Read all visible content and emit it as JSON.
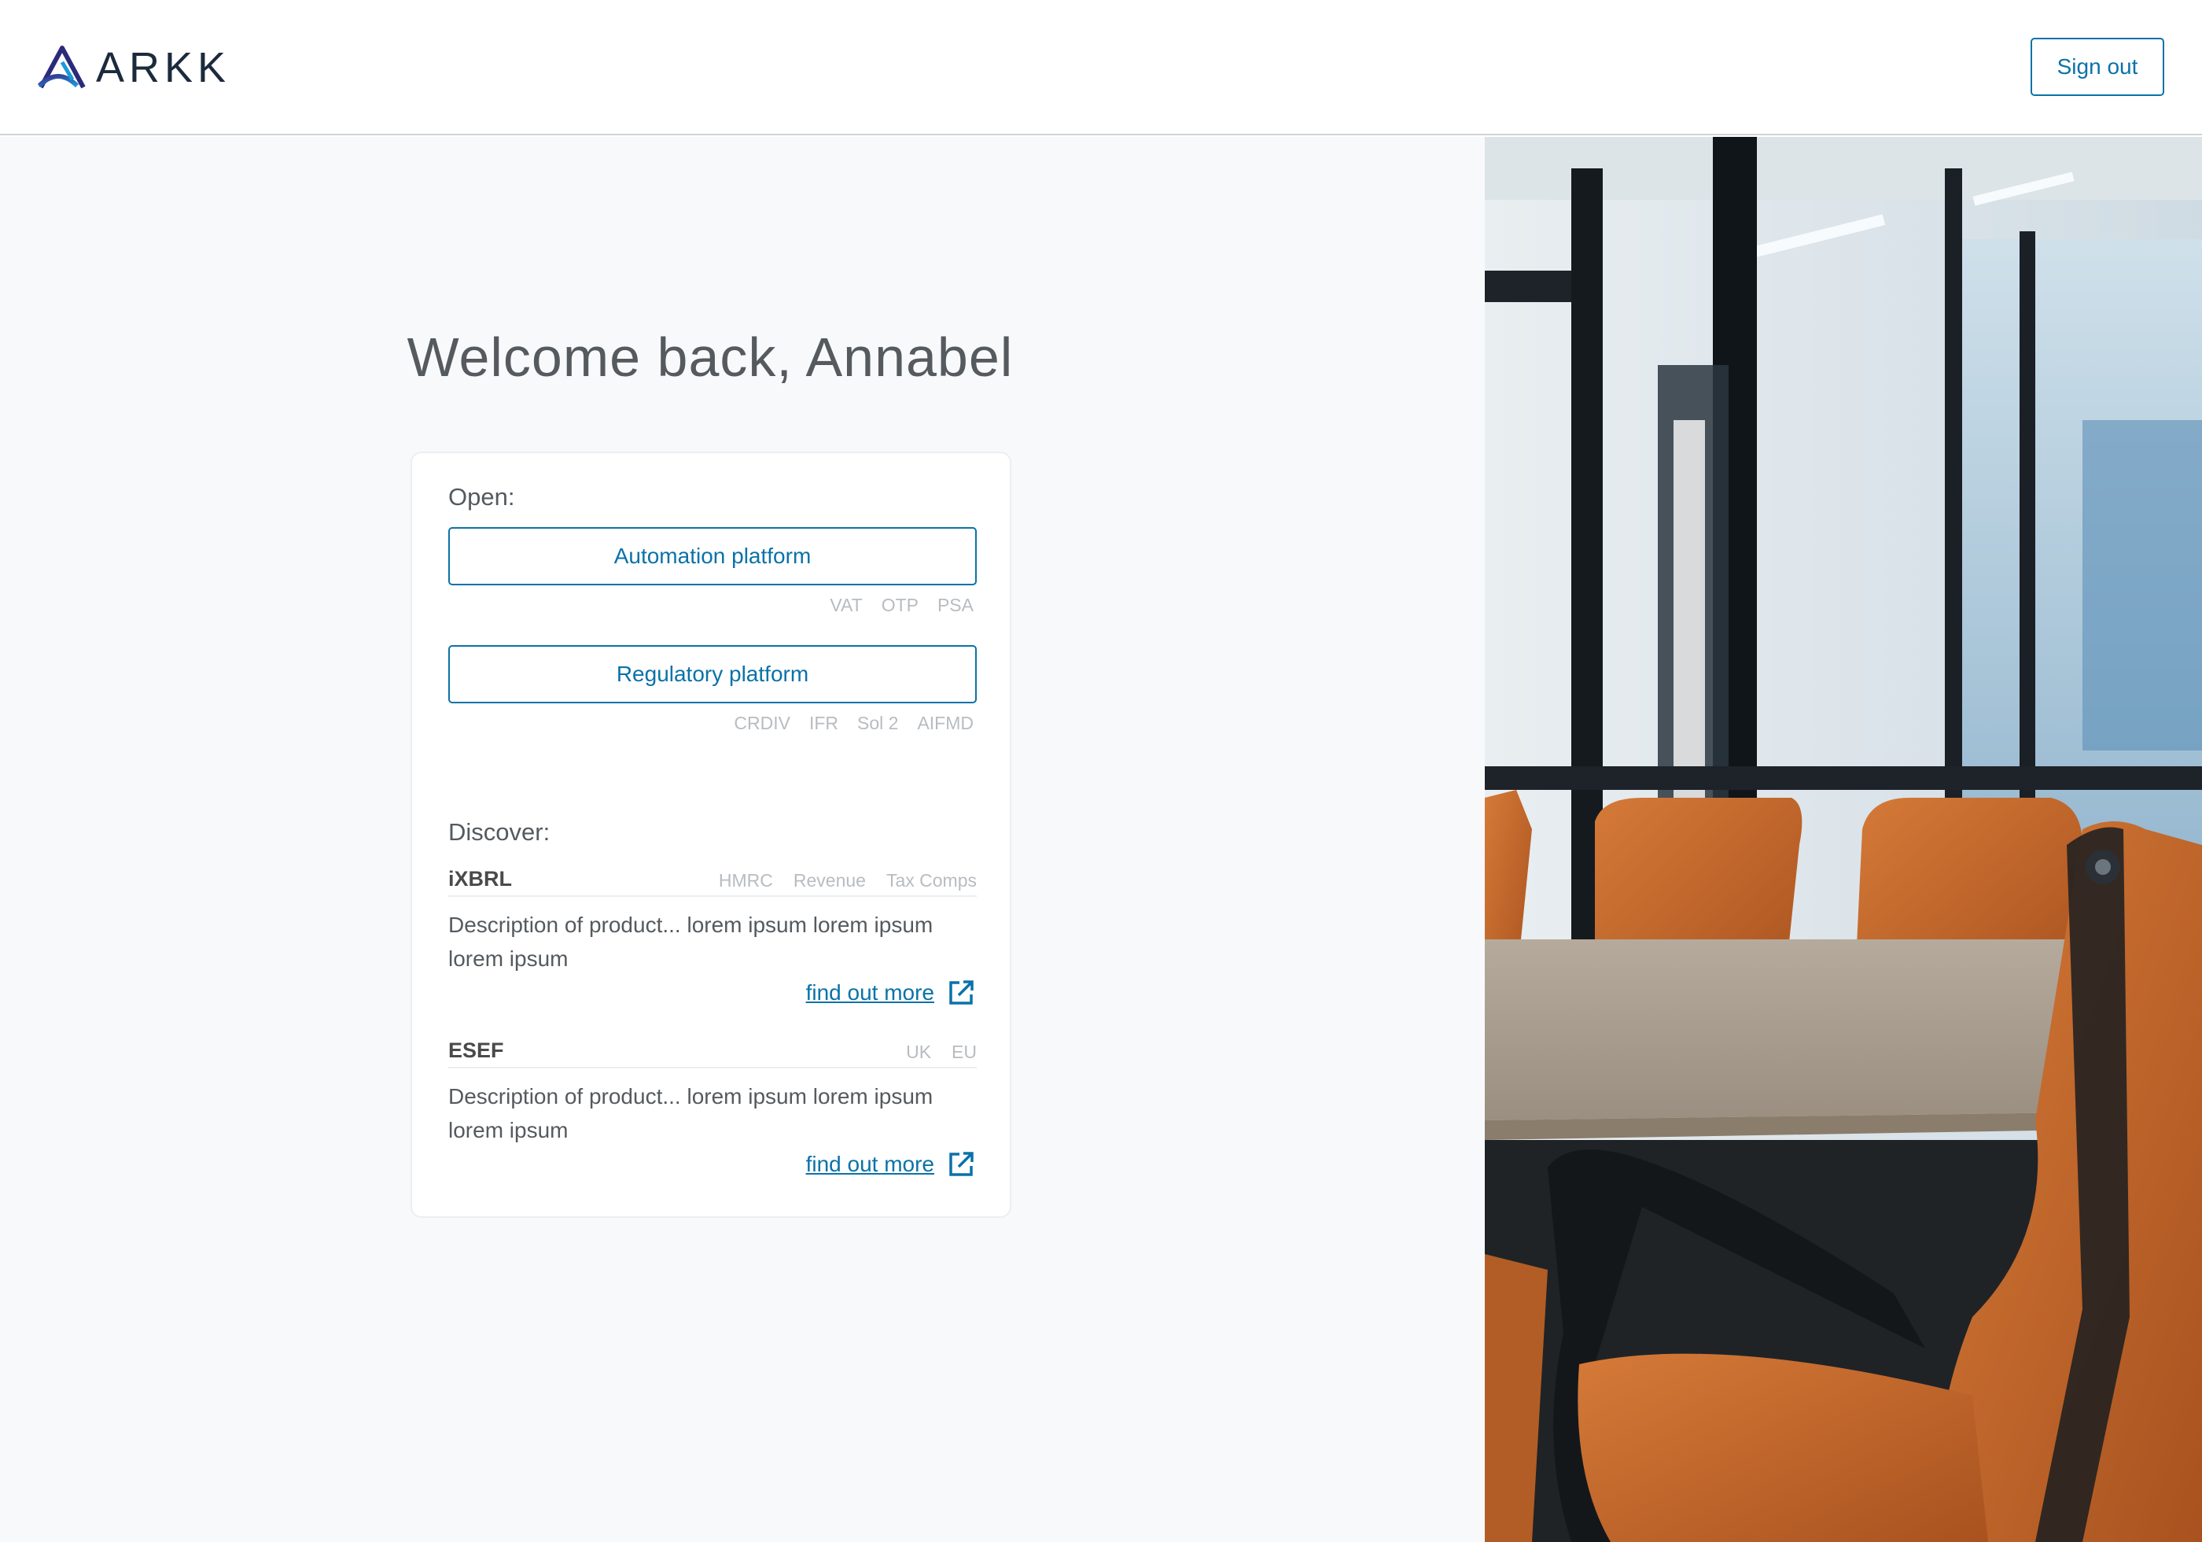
{
  "brand": {
    "name": "ARKK"
  },
  "header": {
    "signout_label": "Sign out"
  },
  "welcome": {
    "text": "Welcome back, Annabel"
  },
  "open": {
    "title": "Open:",
    "platforms": [
      {
        "label": "Automation platform",
        "tags": [
          "VAT",
          "OTP",
          "PSA"
        ]
      },
      {
        "label": "Regulatory platform",
        "tags": [
          "CRDIV",
          "IFR",
          "Sol 2",
          "AIFMD"
        ]
      }
    ]
  },
  "discover": {
    "title": "Discover:",
    "products": [
      {
        "name": "iXBRL",
        "tags": [
          "HMRC",
          "Revenue",
          "Tax Comps"
        ],
        "description": "Description of product... lorem ipsum lorem ipsum lorem ipsum",
        "link_label": "find out more"
      },
      {
        "name": "ESEF",
        "tags": [
          "UK",
          "EU"
        ],
        "description": "Description of product... lorem ipsum lorem ipsum lorem ipsum",
        "link_label": "find out more"
      }
    ]
  },
  "colors": {
    "accent": "#0a72a8",
    "left_background": "#f8f9fa",
    "tag_gray": "#b8bcc0",
    "chair_orange": "#c8692c"
  },
  "icons": {
    "logo": "arkk-triangle-logo",
    "external_link": "external-link-icon"
  }
}
